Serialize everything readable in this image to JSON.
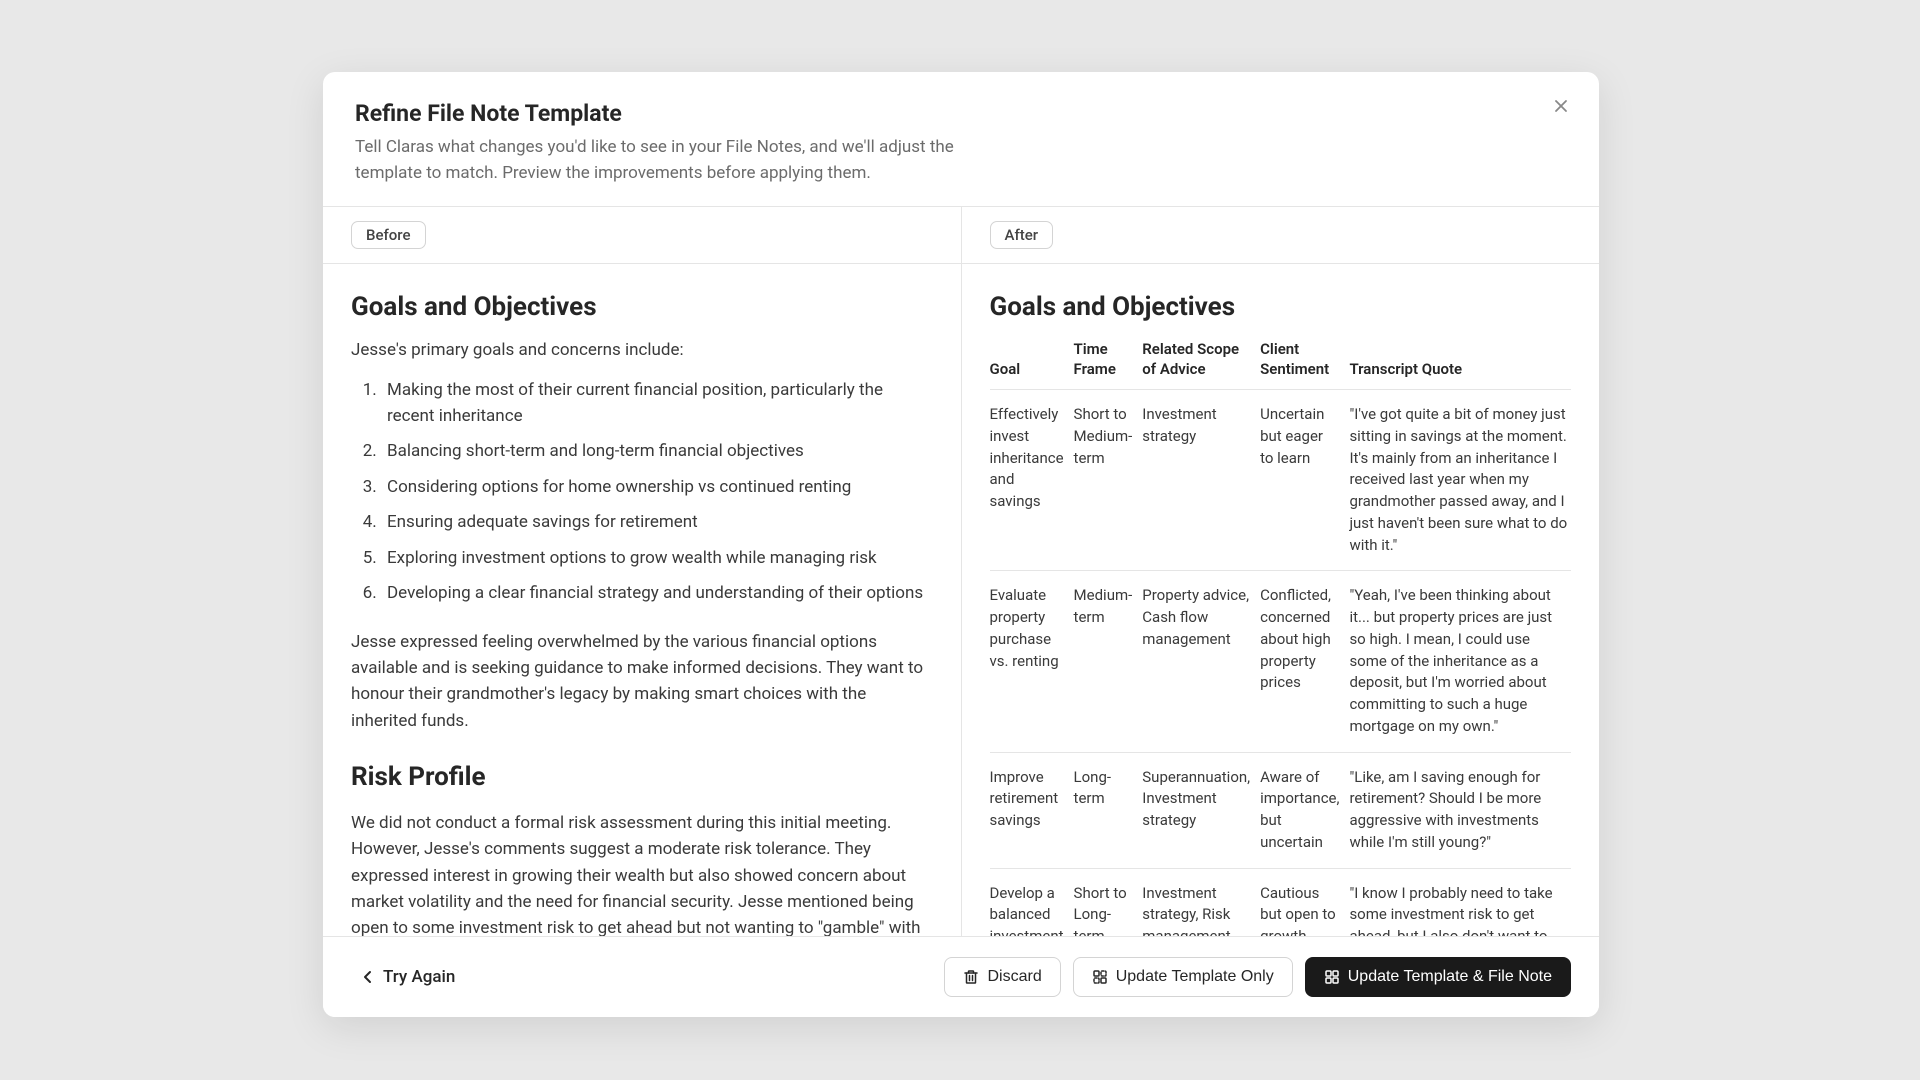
{
  "modal": {
    "title": "Refine File Note Template",
    "subtitle": "Tell Claras what changes you'd like to see in your File Notes, and we'll adjust the template to match. Preview the improvements before applying them."
  },
  "labels": {
    "before": "Before",
    "after": "After"
  },
  "before": {
    "heading": "Goals and Objectives",
    "intro": "Jesse's primary goals and concerns include:",
    "goals": [
      "Making the most of their current financial position, particularly the recent inheritance",
      "Balancing short-term and long-term financial objectives",
      "Considering options for home ownership vs continued renting",
      "Ensuring adequate savings for retirement",
      "Exploring investment options to grow wealth while managing risk",
      "Developing a clear financial strategy and understanding of their options"
    ],
    "summary": "Jesse expressed feeling overwhelmed by the various financial options available and is seeking guidance to make informed decisions. They want to honour their grandmother's legacy by making smart choices with the inherited funds.",
    "risk_heading": "Risk Profile",
    "risk_body": "We did not conduct a formal risk assessment during this initial meeting. However, Jesse's comments suggest a moderate risk tolerance. They expressed interest in growing their wealth but also showed concern about market volatility and the need for financial security. Jesse mentioned being open to some investment risk to get ahead but not wanting to \"gamble\" with the inheritance. A full risk profile assessment will be conducted in our next meeting if Jesse decides to proceed."
  },
  "after": {
    "heading": "Goals and Objectives",
    "columns": [
      "Goal",
      "Time Frame",
      "Related Scope of Advice",
      "Client Sentiment",
      "Transcript Quote"
    ],
    "rows": [
      {
        "goal": "Effectively invest inheritance and savings",
        "time": "Short to Medium-term",
        "scope": "Investment strategy",
        "sentiment": "Uncertain but eager to learn",
        "quote": "\"I've got quite a bit of money just sitting in savings at the moment. It's mainly from an inheritance I received last year when my grandmother passed away, and I just haven't been sure what to do with it.\""
      },
      {
        "goal": "Evaluate property purchase vs. renting",
        "time": "Medium-term",
        "scope": "Property advice, Cash flow management",
        "sentiment": "Conflicted, concerned about high property prices",
        "quote": "\"Yeah, I've been thinking about it... but property prices are just so high. I mean, I could use some of the inheritance as a deposit, but I'm worried about committing to such a huge mortgage on my own.\""
      },
      {
        "goal": "Improve retirement savings",
        "time": "Long-term",
        "scope": "Superannuation, Investment strategy",
        "sentiment": "Aware of importance, but uncertain",
        "quote": "\"Like, am I saving enough for retirement? Should I be more aggressive with investments while I'm still young?\""
      },
      {
        "goal": "Develop a balanced investment approach",
        "time": "Short to Long-term",
        "scope": "Investment strategy, Risk management",
        "sentiment": "Cautious but open to growth",
        "quote": "\"I know I probably need to take some investment risk to get ahead, but I also don't want to gamble with the inheritance.\""
      }
    ]
  },
  "footer": {
    "try_again": "Try Again",
    "discard": "Discard",
    "update_template": "Update Template Only",
    "update_both": "Update Template & File Note"
  }
}
